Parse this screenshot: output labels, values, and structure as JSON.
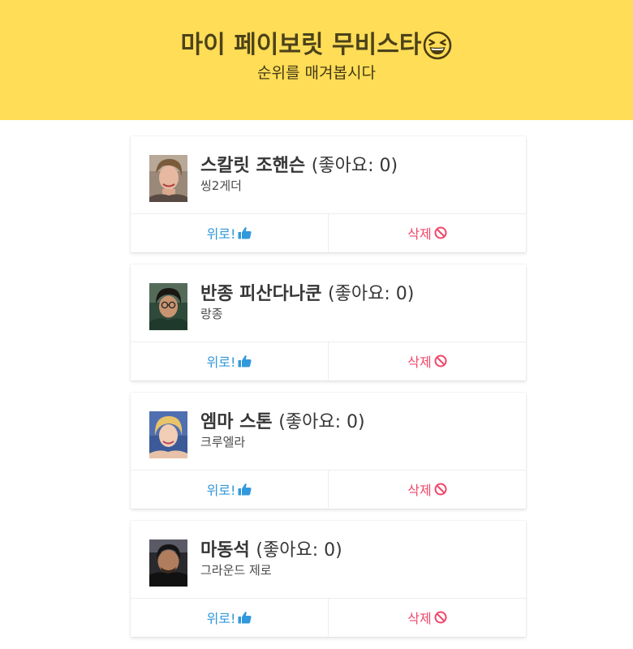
{
  "header": {
    "title": "마이 페이보릿 무비스타",
    "subtitle": "순위를 매겨봅시다",
    "emoji": "grinning-squinting-face"
  },
  "likes_prefix": "(좋아요",
  "likes_suffix": ")",
  "actions": {
    "like_label": "위로!",
    "delete_label": "삭제",
    "like_icon": "thumbs-up-icon",
    "delete_icon": "ban-icon"
  },
  "colors": {
    "hero": "#ffdd57",
    "like": "#3298dc",
    "delete": "#f14668"
  },
  "stars": [
    {
      "name": "스칼릿 조핸슨",
      "likes": "0",
      "role": "씽2게더"
    },
    {
      "name": "반종 피산다나쿤",
      "likes": "0",
      "role": "랑종"
    },
    {
      "name": "엠마 스톤",
      "likes": "0",
      "role": "크루엘라"
    },
    {
      "name": "마동석",
      "likes": "0",
      "role": "그라운드 제로"
    }
  ]
}
